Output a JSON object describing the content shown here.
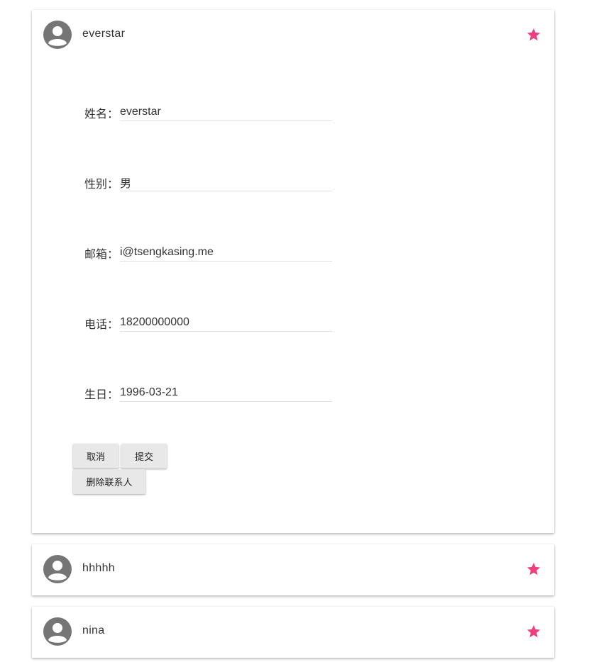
{
  "colors": {
    "star": "#ee4080",
    "avatar_bg": "#757575",
    "button_bg": "#e8e8e8"
  },
  "contacts": [
    {
      "name": "everstar",
      "favorite": true,
      "avatar_icon": "account-circle-icon",
      "star_icon": "star-icon",
      "form": {
        "fields": [
          {
            "label": "姓名：",
            "value": "everstar"
          },
          {
            "label": "性别：",
            "value": "男"
          },
          {
            "label": "邮箱：",
            "value": "i@tsengkasing.me"
          },
          {
            "label": "电话：",
            "value": "18200000000"
          },
          {
            "label": "生日：",
            "value": "1996-03-21"
          }
        ],
        "buttons": {
          "cancel": "取消",
          "submit": "提交",
          "delete": "删除联系人"
        }
      }
    },
    {
      "name": "hhhhh",
      "favorite": true,
      "avatar_icon": "account-circle-icon",
      "star_icon": "star-icon"
    },
    {
      "name": "nina",
      "favorite": true,
      "avatar_icon": "account-circle-icon",
      "star_icon": "star-icon"
    }
  ]
}
